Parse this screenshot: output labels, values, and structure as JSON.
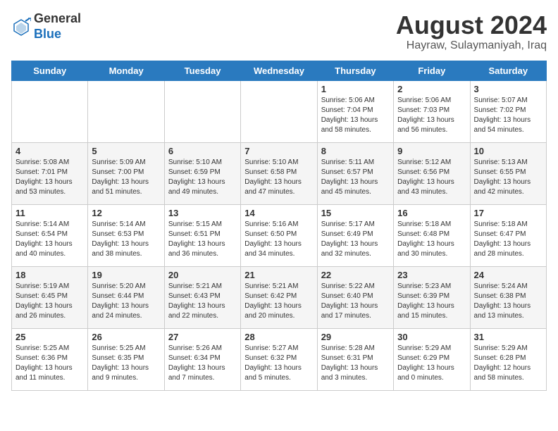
{
  "header": {
    "logo_line1": "General",
    "logo_line2": "Blue",
    "title": "August 2024",
    "subtitle": "Hayraw, Sulaymaniyah, Iraq"
  },
  "weekdays": [
    "Sunday",
    "Monday",
    "Tuesday",
    "Wednesday",
    "Thursday",
    "Friday",
    "Saturday"
  ],
  "weeks": [
    [
      {
        "day": "",
        "info": ""
      },
      {
        "day": "",
        "info": ""
      },
      {
        "day": "",
        "info": ""
      },
      {
        "day": "",
        "info": ""
      },
      {
        "day": "1",
        "info": "Sunrise: 5:06 AM\nSunset: 7:04 PM\nDaylight: 13 hours\nand 58 minutes."
      },
      {
        "day": "2",
        "info": "Sunrise: 5:06 AM\nSunset: 7:03 PM\nDaylight: 13 hours\nand 56 minutes."
      },
      {
        "day": "3",
        "info": "Sunrise: 5:07 AM\nSunset: 7:02 PM\nDaylight: 13 hours\nand 54 minutes."
      }
    ],
    [
      {
        "day": "4",
        "info": "Sunrise: 5:08 AM\nSunset: 7:01 PM\nDaylight: 13 hours\nand 53 minutes."
      },
      {
        "day": "5",
        "info": "Sunrise: 5:09 AM\nSunset: 7:00 PM\nDaylight: 13 hours\nand 51 minutes."
      },
      {
        "day": "6",
        "info": "Sunrise: 5:10 AM\nSunset: 6:59 PM\nDaylight: 13 hours\nand 49 minutes."
      },
      {
        "day": "7",
        "info": "Sunrise: 5:10 AM\nSunset: 6:58 PM\nDaylight: 13 hours\nand 47 minutes."
      },
      {
        "day": "8",
        "info": "Sunrise: 5:11 AM\nSunset: 6:57 PM\nDaylight: 13 hours\nand 45 minutes."
      },
      {
        "day": "9",
        "info": "Sunrise: 5:12 AM\nSunset: 6:56 PM\nDaylight: 13 hours\nand 43 minutes."
      },
      {
        "day": "10",
        "info": "Sunrise: 5:13 AM\nSunset: 6:55 PM\nDaylight: 13 hours\nand 42 minutes."
      }
    ],
    [
      {
        "day": "11",
        "info": "Sunrise: 5:14 AM\nSunset: 6:54 PM\nDaylight: 13 hours\nand 40 minutes."
      },
      {
        "day": "12",
        "info": "Sunrise: 5:14 AM\nSunset: 6:53 PM\nDaylight: 13 hours\nand 38 minutes."
      },
      {
        "day": "13",
        "info": "Sunrise: 5:15 AM\nSunset: 6:51 PM\nDaylight: 13 hours\nand 36 minutes."
      },
      {
        "day": "14",
        "info": "Sunrise: 5:16 AM\nSunset: 6:50 PM\nDaylight: 13 hours\nand 34 minutes."
      },
      {
        "day": "15",
        "info": "Sunrise: 5:17 AM\nSunset: 6:49 PM\nDaylight: 13 hours\nand 32 minutes."
      },
      {
        "day": "16",
        "info": "Sunrise: 5:18 AM\nSunset: 6:48 PM\nDaylight: 13 hours\nand 30 minutes."
      },
      {
        "day": "17",
        "info": "Sunrise: 5:18 AM\nSunset: 6:47 PM\nDaylight: 13 hours\nand 28 minutes."
      }
    ],
    [
      {
        "day": "18",
        "info": "Sunrise: 5:19 AM\nSunset: 6:45 PM\nDaylight: 13 hours\nand 26 minutes."
      },
      {
        "day": "19",
        "info": "Sunrise: 5:20 AM\nSunset: 6:44 PM\nDaylight: 13 hours\nand 24 minutes."
      },
      {
        "day": "20",
        "info": "Sunrise: 5:21 AM\nSunset: 6:43 PM\nDaylight: 13 hours\nand 22 minutes."
      },
      {
        "day": "21",
        "info": "Sunrise: 5:21 AM\nSunset: 6:42 PM\nDaylight: 13 hours\nand 20 minutes."
      },
      {
        "day": "22",
        "info": "Sunrise: 5:22 AM\nSunset: 6:40 PM\nDaylight: 13 hours\nand 17 minutes."
      },
      {
        "day": "23",
        "info": "Sunrise: 5:23 AM\nSunset: 6:39 PM\nDaylight: 13 hours\nand 15 minutes."
      },
      {
        "day": "24",
        "info": "Sunrise: 5:24 AM\nSunset: 6:38 PM\nDaylight: 13 hours\nand 13 minutes."
      }
    ],
    [
      {
        "day": "25",
        "info": "Sunrise: 5:25 AM\nSunset: 6:36 PM\nDaylight: 13 hours\nand 11 minutes."
      },
      {
        "day": "26",
        "info": "Sunrise: 5:25 AM\nSunset: 6:35 PM\nDaylight: 13 hours\nand 9 minutes."
      },
      {
        "day": "27",
        "info": "Sunrise: 5:26 AM\nSunset: 6:34 PM\nDaylight: 13 hours\nand 7 minutes."
      },
      {
        "day": "28",
        "info": "Sunrise: 5:27 AM\nSunset: 6:32 PM\nDaylight: 13 hours\nand 5 minutes."
      },
      {
        "day": "29",
        "info": "Sunrise: 5:28 AM\nSunset: 6:31 PM\nDaylight: 13 hours\nand 3 minutes."
      },
      {
        "day": "30",
        "info": "Sunrise: 5:29 AM\nSunset: 6:29 PM\nDaylight: 13 hours\nand 0 minutes."
      },
      {
        "day": "31",
        "info": "Sunrise: 5:29 AM\nSunset: 6:28 PM\nDaylight: 12 hours\nand 58 minutes."
      }
    ]
  ]
}
